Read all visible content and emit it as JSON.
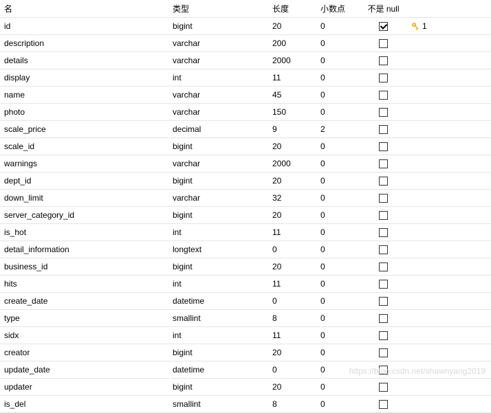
{
  "headers": {
    "name": "名",
    "type": "类型",
    "length": "长度",
    "scale": "小数点",
    "not_null": "不是 null",
    "key": ""
  },
  "rows": [
    {
      "name": "id",
      "type": "bigint",
      "length": "20",
      "scale": "0",
      "not_null": true,
      "key": "1"
    },
    {
      "name": "description",
      "type": "varchar",
      "length": "200",
      "scale": "0",
      "not_null": false,
      "key": ""
    },
    {
      "name": "details",
      "type": "varchar",
      "length": "2000",
      "scale": "0",
      "not_null": false,
      "key": ""
    },
    {
      "name": "display",
      "type": "int",
      "length": "11",
      "scale": "0",
      "not_null": false,
      "key": ""
    },
    {
      "name": "name",
      "type": "varchar",
      "length": "45",
      "scale": "0",
      "not_null": false,
      "key": ""
    },
    {
      "name": "photo",
      "type": "varchar",
      "length": "150",
      "scale": "0",
      "not_null": false,
      "key": ""
    },
    {
      "name": "scale_price",
      "type": "decimal",
      "length": "9",
      "scale": "2",
      "not_null": false,
      "key": ""
    },
    {
      "name": "scale_id",
      "type": "bigint",
      "length": "20",
      "scale": "0",
      "not_null": false,
      "key": ""
    },
    {
      "name": "warnings",
      "type": "varchar",
      "length": "2000",
      "scale": "0",
      "not_null": false,
      "key": ""
    },
    {
      "name": "dept_id",
      "type": "bigint",
      "length": "20",
      "scale": "0",
      "not_null": false,
      "key": ""
    },
    {
      "name": "down_limit",
      "type": "varchar",
      "length": "32",
      "scale": "0",
      "not_null": false,
      "key": ""
    },
    {
      "name": "server_category_id",
      "type": "bigint",
      "length": "20",
      "scale": "0",
      "not_null": false,
      "key": ""
    },
    {
      "name": "is_hot",
      "type": "int",
      "length": "11",
      "scale": "0",
      "not_null": false,
      "key": ""
    },
    {
      "name": "detail_information",
      "type": "longtext",
      "length": "0",
      "scale": "0",
      "not_null": false,
      "key": ""
    },
    {
      "name": "business_id",
      "type": "bigint",
      "length": "20",
      "scale": "0",
      "not_null": false,
      "key": ""
    },
    {
      "name": "hits",
      "type": "int",
      "length": "11",
      "scale": "0",
      "not_null": false,
      "key": ""
    },
    {
      "name": "create_date",
      "type": "datetime",
      "length": "0",
      "scale": "0",
      "not_null": false,
      "key": ""
    },
    {
      "name": "type",
      "type": "smallint",
      "length": "8",
      "scale": "0",
      "not_null": false,
      "key": ""
    },
    {
      "name": "sidx",
      "type": "int",
      "length": "11",
      "scale": "0",
      "not_null": false,
      "key": ""
    },
    {
      "name": "creator",
      "type": "bigint",
      "length": "20",
      "scale": "0",
      "not_null": false,
      "key": ""
    },
    {
      "name": "update_date",
      "type": "datetime",
      "length": "0",
      "scale": "0",
      "not_null": false,
      "key": ""
    },
    {
      "name": "updater",
      "type": "bigint",
      "length": "20",
      "scale": "0",
      "not_null": false,
      "key": ""
    },
    {
      "name": "is_del",
      "type": "smallint",
      "length": "8",
      "scale": "0",
      "not_null": false,
      "key": ""
    }
  ],
  "watermark": "https://blog.csdn.net/shawnyang2019"
}
